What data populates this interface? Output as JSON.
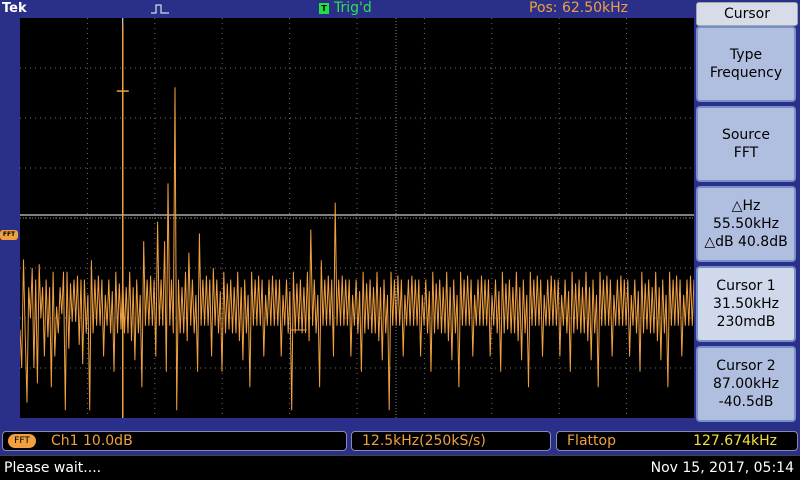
{
  "header": {
    "brand": "Tek",
    "trigger_badge": "T",
    "trigger_status": "Trig'd",
    "position": "Pos: 62.50kHz"
  },
  "left_marker": {
    "label": "FFT"
  },
  "menu": {
    "title": "Cursor",
    "buttons": [
      {
        "line1": "Type",
        "line2": "Frequency",
        "line3": ""
      },
      {
        "line1": "Source",
        "line2": "FFT",
        "line3": ""
      },
      {
        "line1": "△Hz",
        "line2": "55.50kHz",
        "line3": "△dB 40.8dB"
      },
      {
        "line1": "Cursor 1",
        "line2": "31.50kHz",
        "line3": "230mdB"
      },
      {
        "line1": "Cursor 2",
        "line2": "87.00kHz",
        "line3": "-40.5dB"
      }
    ]
  },
  "status": {
    "channel_badge": "FFT",
    "channel": "Ch1  10.0dB",
    "span": "12.5kHz(250kS/s)",
    "window": "Flattop",
    "frequency": "127.674kHz"
  },
  "message": {
    "text": "Please wait....",
    "datetime": "Nov 15, 2017, 05:14"
  },
  "colors": {
    "trace": "#f0a040",
    "grid": "#707070",
    "background": "#2a2f8a",
    "trigger": "#30e050"
  },
  "chart_data": {
    "type": "line",
    "series": [
      {
        "values": [
          -19,
          -29,
          -0.8,
          -20,
          -38,
          -8,
          -16,
          -3,
          -29,
          -6,
          -33,
          -2,
          -16,
          -8,
          -26,
          -6,
          -21,
          -8,
          -34,
          -4,
          -26,
          -13,
          -20,
          -8,
          -15,
          -4,
          -40,
          -4,
          -24,
          -7,
          -17,
          -6,
          -17,
          -5,
          -23,
          -6,
          -28,
          -6,
          -20,
          -10,
          -40,
          -1,
          -20,
          -6,
          -18,
          -5,
          -18,
          -6,
          -26,
          -10,
          -18,
          -6,
          -20,
          -9,
          -30,
          -4,
          -20,
          -7,
          -19,
          -6,
          -20,
          -8,
          -20,
          -4,
          -22,
          -8,
          -27,
          -6,
          -20,
          -10,
          -34,
          4,
          -18,
          -6,
          -18,
          -5,
          -18,
          -6,
          -26,
          9,
          -18,
          -6,
          -18,
          4,
          -30,
          19,
          -18,
          -6,
          -20,
          44,
          -40,
          -6,
          -20,
          -8,
          -20,
          -4,
          -22,
          1,
          -18,
          -6,
          -20,
          -10,
          -30,
          6,
          -18,
          -6,
          -18,
          -5,
          -18,
          -6,
          -26,
          -3,
          -18,
          -6,
          -20,
          -9,
          -30,
          -4,
          -20,
          -7,
          -19,
          -6,
          -20,
          -8,
          -20,
          -4,
          -22,
          -8,
          -27,
          -6,
          -20,
          -10,
          -34,
          -4,
          -18,
          -6,
          -18,
          -5,
          -18,
          -6,
          -26,
          -10,
          -18,
          -6,
          -18,
          -5,
          -18,
          -6,
          -18,
          -6,
          -26,
          -10,
          -18,
          -6,
          -20,
          -9,
          -40,
          -4,
          -20,
          -7,
          -19,
          -6,
          -20,
          -8,
          -20,
          -4,
          -22,
          7,
          -18,
          -6,
          -20,
          -10,
          -34,
          -1,
          -18,
          -6,
          -18,
          -5,
          -18,
          -6,
          -26,
          14,
          -18,
          -6,
          -18,
          -5,
          -18,
          -6,
          -18,
          -6,
          -26,
          -10,
          -18,
          -6,
          -20,
          -9,
          -30,
          -4,
          -20,
          -7,
          -19,
          -6,
          -20,
          -8,
          -20,
          -4,
          -22,
          -8,
          -27,
          -6,
          -20,
          -10,
          -40,
          -4,
          -18,
          -6,
          -18,
          -5,
          -18,
          -6,
          -26,
          -10,
          -18,
          -6,
          -18,
          -5,
          -18,
          -6,
          -18,
          -6,
          -26,
          -10,
          -18,
          -6,
          -20,
          -9,
          -30,
          -4,
          -20,
          -7,
          -19,
          -6,
          -20,
          -8,
          -20,
          -4,
          -22,
          -8,
          -27,
          -6,
          -20,
          -10,
          -34,
          -4,
          -18,
          -6,
          -18,
          -5,
          -18,
          -6,
          -26,
          -10,
          -18,
          -6,
          -18,
          -5,
          -18,
          -6,
          -18,
          -6,
          -26,
          -10,
          -18,
          -6,
          -20,
          -9,
          -30,
          -4,
          -20,
          -7,
          -19,
          -6,
          -20,
          -8,
          -20,
          -4,
          -22,
          -8,
          -27,
          -6,
          -20,
          -10,
          -34,
          -4,
          -18,
          -6,
          -18,
          -5,
          -18,
          -6,
          -26,
          -10,
          -18,
          -6,
          -18,
          -5,
          -18,
          -6,
          -18,
          -6,
          -26,
          -10,
          -18,
          -6,
          -20,
          -9,
          -30,
          -4,
          -20,
          -7,
          -19,
          -6,
          -20,
          -8,
          -20,
          -4,
          -22,
          -8,
          -27,
          -6,
          -20,
          -10,
          -34,
          -4,
          -18,
          -6,
          -18,
          -5,
          -18,
          -6,
          -26,
          -10,
          -18,
          -6,
          -18,
          -5,
          -18,
          -6,
          -18,
          -6,
          -26,
          -10,
          -18,
          -6,
          -20,
          -9,
          -30,
          -4,
          -20,
          -7,
          -19,
          -6,
          -20,
          -8,
          -20,
          -4,
          -22,
          -8,
          -27,
          -6,
          -20,
          -10,
          -34,
          -4,
          -18,
          -6,
          -18,
          -5,
          -18,
          -6,
          -26,
          -10,
          -18,
          -6,
          -18,
          -5,
          -18,
          -6
        ]
      }
    ],
    "ylim": [
      -42,
      62
    ],
    "grid": true,
    "cursor1_index": 59,
    "cursor2_index": 160,
    "spike_index": 70,
    "spike_value": 60,
    "spike_marker_value": 43
  }
}
